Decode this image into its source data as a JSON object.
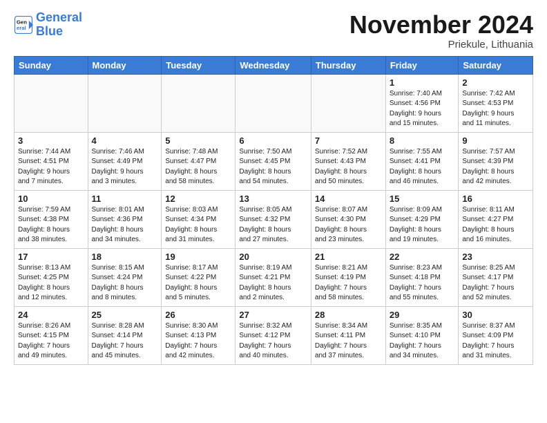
{
  "logo": {
    "line1": "General",
    "line2": "Blue"
  },
  "title": "November 2024",
  "location": "Priekule, Lithuania",
  "weekdays": [
    "Sunday",
    "Monday",
    "Tuesday",
    "Wednesday",
    "Thursday",
    "Friday",
    "Saturday"
  ],
  "weeks": [
    [
      {
        "day": "",
        "info": ""
      },
      {
        "day": "",
        "info": ""
      },
      {
        "day": "",
        "info": ""
      },
      {
        "day": "",
        "info": ""
      },
      {
        "day": "",
        "info": ""
      },
      {
        "day": "1",
        "info": "Sunrise: 7:40 AM\nSunset: 4:56 PM\nDaylight: 9 hours\nand 15 minutes."
      },
      {
        "day": "2",
        "info": "Sunrise: 7:42 AM\nSunset: 4:53 PM\nDaylight: 9 hours\nand 11 minutes."
      }
    ],
    [
      {
        "day": "3",
        "info": "Sunrise: 7:44 AM\nSunset: 4:51 PM\nDaylight: 9 hours\nand 7 minutes."
      },
      {
        "day": "4",
        "info": "Sunrise: 7:46 AM\nSunset: 4:49 PM\nDaylight: 9 hours\nand 3 minutes."
      },
      {
        "day": "5",
        "info": "Sunrise: 7:48 AM\nSunset: 4:47 PM\nDaylight: 8 hours\nand 58 minutes."
      },
      {
        "day": "6",
        "info": "Sunrise: 7:50 AM\nSunset: 4:45 PM\nDaylight: 8 hours\nand 54 minutes."
      },
      {
        "day": "7",
        "info": "Sunrise: 7:52 AM\nSunset: 4:43 PM\nDaylight: 8 hours\nand 50 minutes."
      },
      {
        "day": "8",
        "info": "Sunrise: 7:55 AM\nSunset: 4:41 PM\nDaylight: 8 hours\nand 46 minutes."
      },
      {
        "day": "9",
        "info": "Sunrise: 7:57 AM\nSunset: 4:39 PM\nDaylight: 8 hours\nand 42 minutes."
      }
    ],
    [
      {
        "day": "10",
        "info": "Sunrise: 7:59 AM\nSunset: 4:38 PM\nDaylight: 8 hours\nand 38 minutes."
      },
      {
        "day": "11",
        "info": "Sunrise: 8:01 AM\nSunset: 4:36 PM\nDaylight: 8 hours\nand 34 minutes."
      },
      {
        "day": "12",
        "info": "Sunrise: 8:03 AM\nSunset: 4:34 PM\nDaylight: 8 hours\nand 31 minutes."
      },
      {
        "day": "13",
        "info": "Sunrise: 8:05 AM\nSunset: 4:32 PM\nDaylight: 8 hours\nand 27 minutes."
      },
      {
        "day": "14",
        "info": "Sunrise: 8:07 AM\nSunset: 4:30 PM\nDaylight: 8 hours\nand 23 minutes."
      },
      {
        "day": "15",
        "info": "Sunrise: 8:09 AM\nSunset: 4:29 PM\nDaylight: 8 hours\nand 19 minutes."
      },
      {
        "day": "16",
        "info": "Sunrise: 8:11 AM\nSunset: 4:27 PM\nDaylight: 8 hours\nand 16 minutes."
      }
    ],
    [
      {
        "day": "17",
        "info": "Sunrise: 8:13 AM\nSunset: 4:25 PM\nDaylight: 8 hours\nand 12 minutes."
      },
      {
        "day": "18",
        "info": "Sunrise: 8:15 AM\nSunset: 4:24 PM\nDaylight: 8 hours\nand 8 minutes."
      },
      {
        "day": "19",
        "info": "Sunrise: 8:17 AM\nSunset: 4:22 PM\nDaylight: 8 hours\nand 5 minutes."
      },
      {
        "day": "20",
        "info": "Sunrise: 8:19 AM\nSunset: 4:21 PM\nDaylight: 8 hours\nand 2 minutes."
      },
      {
        "day": "21",
        "info": "Sunrise: 8:21 AM\nSunset: 4:19 PM\nDaylight: 7 hours\nand 58 minutes."
      },
      {
        "day": "22",
        "info": "Sunrise: 8:23 AM\nSunset: 4:18 PM\nDaylight: 7 hours\nand 55 minutes."
      },
      {
        "day": "23",
        "info": "Sunrise: 8:25 AM\nSunset: 4:17 PM\nDaylight: 7 hours\nand 52 minutes."
      }
    ],
    [
      {
        "day": "24",
        "info": "Sunrise: 8:26 AM\nSunset: 4:15 PM\nDaylight: 7 hours\nand 49 minutes."
      },
      {
        "day": "25",
        "info": "Sunrise: 8:28 AM\nSunset: 4:14 PM\nDaylight: 7 hours\nand 45 minutes."
      },
      {
        "day": "26",
        "info": "Sunrise: 8:30 AM\nSunset: 4:13 PM\nDaylight: 7 hours\nand 42 minutes."
      },
      {
        "day": "27",
        "info": "Sunrise: 8:32 AM\nSunset: 4:12 PM\nDaylight: 7 hours\nand 40 minutes."
      },
      {
        "day": "28",
        "info": "Sunrise: 8:34 AM\nSunset: 4:11 PM\nDaylight: 7 hours\nand 37 minutes."
      },
      {
        "day": "29",
        "info": "Sunrise: 8:35 AM\nSunset: 4:10 PM\nDaylight: 7 hours\nand 34 minutes."
      },
      {
        "day": "30",
        "info": "Sunrise: 8:37 AM\nSunset: 4:09 PM\nDaylight: 7 hours\nand 31 minutes."
      }
    ]
  ]
}
